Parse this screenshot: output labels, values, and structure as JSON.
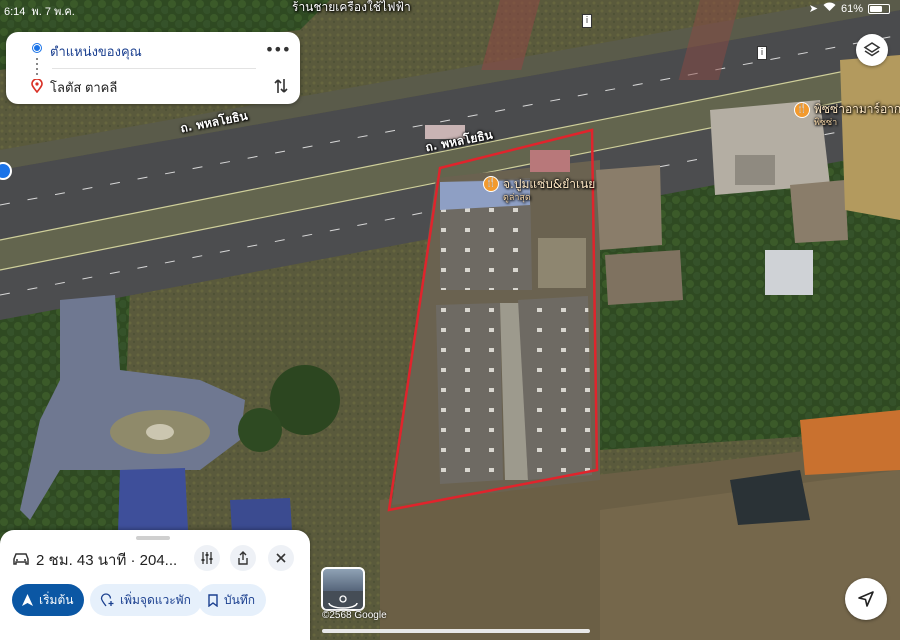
{
  "status_bar": {
    "time": "6:14",
    "date": "พ. 7 พ.ค.",
    "battery": "61%"
  },
  "route": {
    "origin": "ตำแหน่งของคุณ",
    "destination": "โลตัส ตาคลี"
  },
  "map": {
    "top_label": "ร้านชายเครื่องใช้ไฟฟ้า",
    "road_label_1": "ถ. พหลโยธิน",
    "road_label_2": "ถ. พหลโยธิน",
    "poi_1": {
      "name": "จ.ปูมแซ่บ&ยำเนย",
      "sub": "ดูล่าสุด"
    },
    "poi_2": {
      "name": "พิซซ่าอามาร์อากง",
      "sub": "พิซซ่า"
    },
    "attribution": "©2568 Google",
    "property_outline_color": "#e0242c"
  },
  "trip": {
    "summary": "2 ชม. 43 นาที · 204..."
  },
  "actions": {
    "start": "เริ่มต้น",
    "add_stop": "เพิ่มจุดแวะพัก",
    "save": "บันทึก"
  },
  "colors": {
    "accent": "#0b57a4",
    "poi": "#f29a2e",
    "pin": "#d93025"
  }
}
